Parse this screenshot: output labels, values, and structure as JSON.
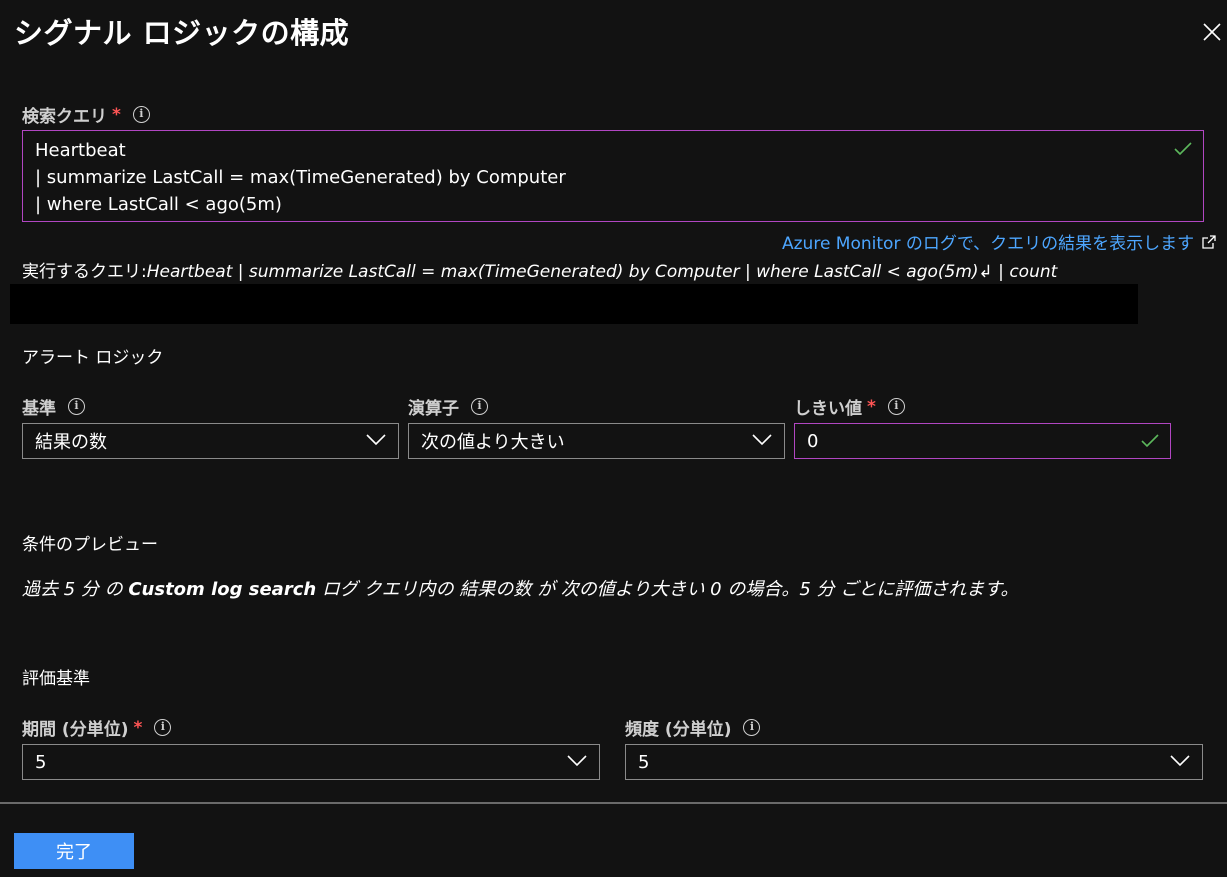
{
  "header": {
    "title": "シグナル ロジックの構成",
    "close_icon": "close-icon"
  },
  "search_query": {
    "label": "検索クエリ",
    "required_mark": "*",
    "lines": [
      "Heartbeat",
      "| summarize LastCall = max(TimeGenerated) by Computer",
      "| where LastCall < ago(5m)"
    ],
    "link_text": "Azure Monitor のログで、クエリの結果を表示します",
    "run_label": "実行するクエリ:",
    "run_text": "Heartbeat | summarize LastCall = max(TimeGenerated) by Computer | where LastCall < ago(5m)↲ | count"
  },
  "alert_logic": {
    "title": "アラート ロジック",
    "basis": {
      "label": "基準",
      "value": "結果の数"
    },
    "operator": {
      "label": "演算子",
      "value": "次の値より大きい"
    },
    "threshold": {
      "label": "しきい値",
      "required_mark": "*",
      "value": "0"
    }
  },
  "preview": {
    "title": "条件のプレビュー",
    "text_part1": "過去 5 分 の ",
    "text_bold": "Custom log search",
    "text_part2": " ログ クエリ内の 結果の数 が 次の値より大きい 0 の場合。5 分 ごとに評価されます。"
  },
  "evaluation": {
    "title": "評価基準",
    "period": {
      "label": "期間 (分単位)",
      "required_mark": "*",
      "value": "5"
    },
    "frequency": {
      "label": "頻度 (分単位)",
      "value": "5"
    }
  },
  "footer": {
    "done_label": "完了"
  },
  "colors": {
    "accent_border": "#b146c2",
    "link": "#4da6ff",
    "button": "#3e8ff5",
    "check": "#5cb85c",
    "required": "#ff5555"
  }
}
